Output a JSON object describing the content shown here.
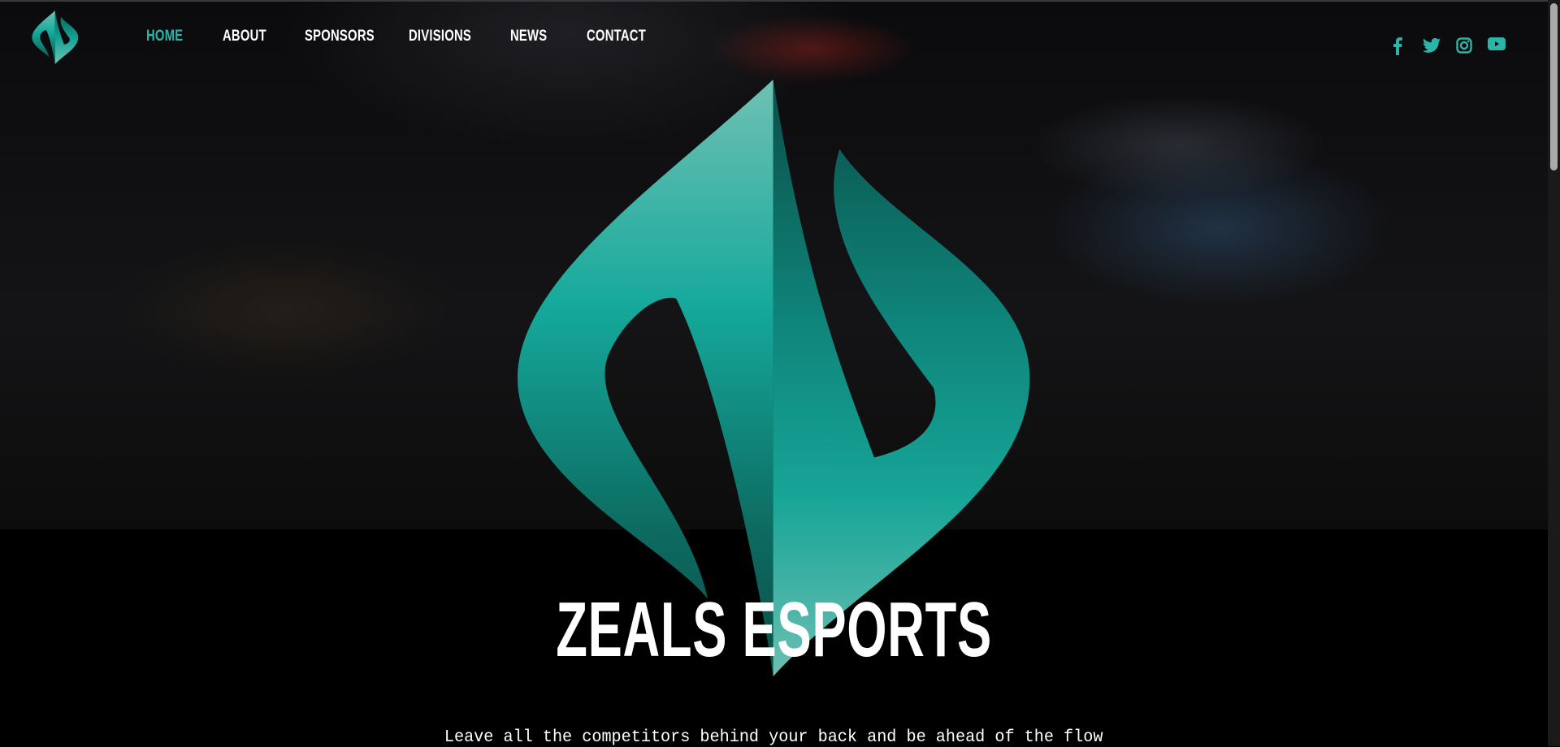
{
  "nav": {
    "items": [
      {
        "label": "HOME",
        "active": true
      },
      {
        "label": "ABOUT",
        "active": false
      },
      {
        "label": "SPONSORS",
        "active": false
      },
      {
        "label": "DIVISIONS",
        "active": false
      },
      {
        "label": "NEWS",
        "active": false
      },
      {
        "label": "CONTACT",
        "active": false
      }
    ]
  },
  "social": [
    "facebook-icon",
    "twitter-icon",
    "instagram-icon",
    "youtube-icon"
  ],
  "hero": {
    "title": "ZEALS ESPORTS",
    "tagline": "Leave all the competitors behind your back and be ahead of the flow"
  },
  "colors": {
    "accent": "#2bb5a8",
    "text": "#ffffff",
    "background": "#000000"
  }
}
